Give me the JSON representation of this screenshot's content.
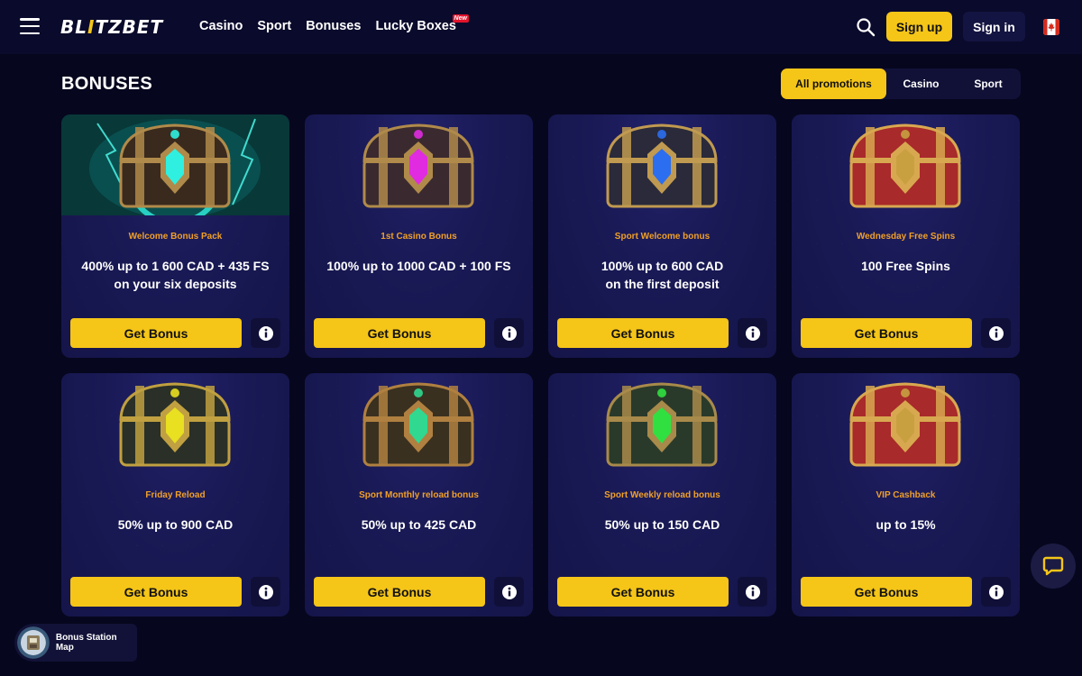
{
  "header": {
    "logo_left": "BL",
    "logo_accent": "I",
    "logo_right": "TZBET",
    "nav": [
      {
        "label": "Casino"
      },
      {
        "label": "Sport"
      },
      {
        "label": "Bonuses"
      },
      {
        "label": "Lucky Boxes",
        "badge": "New"
      }
    ],
    "signup_label": "Sign up",
    "signin_label": "Sign in",
    "icons": {
      "menu": "hamburger-icon",
      "search": "search-icon",
      "flag": "canada-flag-icon"
    }
  },
  "page": {
    "title": "BONUSES",
    "filters": [
      {
        "label": "All promotions",
        "active": true
      },
      {
        "label": "Casino",
        "active": false
      },
      {
        "label": "Sport",
        "active": false
      }
    ]
  },
  "cards": [
    {
      "label": "Welcome Bonus Pack",
      "desc_line1": "400% up to 1 600 CAD + 435 FS",
      "desc_line2": "on your six deposits",
      "button": "Get Bonus",
      "chest": "teal-lightning-chest"
    },
    {
      "label": "1st Casino Bonus",
      "desc_line1": "100% up to 1000 CAD + 100 FS",
      "desc_line2": "",
      "button": "Get Bonus",
      "chest": "magenta-chest"
    },
    {
      "label": "Sport Welcome bonus",
      "desc_line1": "100% up to 600 CAD",
      "desc_line2": "on the first deposit",
      "button": "Get Bonus",
      "chest": "blue-chest"
    },
    {
      "label": "Wednesday Free Spins",
      "desc_line1": "100 Free Spins",
      "desc_line2": "",
      "button": "Get Bonus",
      "chest": "red-chest"
    },
    {
      "label": "Friday Reload",
      "desc_line1": "50% up to 900 CAD",
      "desc_line2": "",
      "button": "Get Bonus",
      "chest": "yellow-chest"
    },
    {
      "label": "Sport Monthly reload bonus",
      "desc_line1": "50% up to 425 CAD",
      "desc_line2": "",
      "button": "Get Bonus",
      "chest": "green-chest"
    },
    {
      "label": "Sport Weekly reload bonus",
      "desc_line1": "50% up to 150 CAD",
      "desc_line2": "",
      "button": "Get Bonus",
      "chest": "emerald-chest"
    },
    {
      "label": "VIP Cashback",
      "desc_line1": "up to 15%",
      "desc_line2": "",
      "button": "Get Bonus",
      "chest": "red-chest"
    }
  ],
  "widgets": {
    "bonus_map_label": "Bonus Station Map",
    "chat_icon": "chat-icon"
  },
  "colors": {
    "accent": "#f5c518",
    "label": "#f0a028",
    "background": "#06061e",
    "card": "#191955"
  }
}
